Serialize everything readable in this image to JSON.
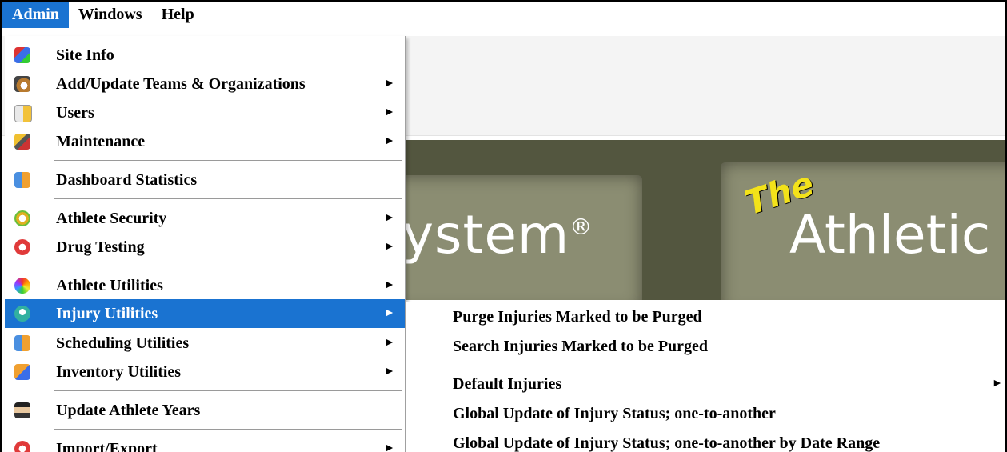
{
  "menubar": {
    "items": [
      {
        "label": "Admin",
        "active": true
      },
      {
        "label": "Windows",
        "active": false
      },
      {
        "label": "Help",
        "active": false
      }
    ]
  },
  "banner": {
    "left_text": "ystem",
    "registered": "®",
    "the_text": "The",
    "right_text": "Athletic"
  },
  "admin_menu": {
    "items": [
      {
        "label": "Site Info",
        "icon": "site-info-icon",
        "submenu": false
      },
      {
        "label": "Add/Update Teams & Organizations",
        "icon": "teams-icon",
        "submenu": true
      },
      {
        "label": "Users",
        "icon": "users-icon",
        "submenu": true
      },
      {
        "label": "Maintenance",
        "icon": "maintenance-icon",
        "submenu": true
      },
      {
        "label": "Dashboard Statistics",
        "icon": "dashboard-icon",
        "submenu": false
      },
      {
        "label": "Athlete Security",
        "icon": "security-icon",
        "submenu": true
      },
      {
        "label": "Drug Testing",
        "icon": "drug-testing-icon",
        "submenu": true
      },
      {
        "label": "Athlete Utilities",
        "icon": "athlete-utilities-icon",
        "submenu": true
      },
      {
        "label": "Injury Utilities",
        "icon": "injury-icon",
        "submenu": true,
        "highlighted": true
      },
      {
        "label": "Scheduling Utilities",
        "icon": "scheduling-icon",
        "submenu": true
      },
      {
        "label": "Inventory Utilities",
        "icon": "inventory-icon",
        "submenu": true
      },
      {
        "label": "Update Athlete Years",
        "icon": "graduate-icon",
        "submenu": false
      },
      {
        "label": "Import/Export",
        "icon": "import-export-icon",
        "submenu": true
      }
    ],
    "arrow_glyph": "►"
  },
  "injury_submenu": {
    "items": [
      {
        "label": "Purge Injuries Marked to be Purged",
        "submenu": false
      },
      {
        "label": "Search Injuries Marked to be Purged",
        "submenu": false
      },
      {
        "label": "Default Injuries",
        "submenu": true
      },
      {
        "label": "Global Update of Injury Status; one-to-another",
        "submenu": false
      },
      {
        "label": "Global Update of Injury Status; one-to-another by Date Range",
        "submenu": false
      }
    ]
  },
  "colors": {
    "highlight": "#1a73d1",
    "the_yellow": "#f3e21a",
    "banner_dark": "#53563f",
    "banner_slab": "#8b8d72"
  }
}
